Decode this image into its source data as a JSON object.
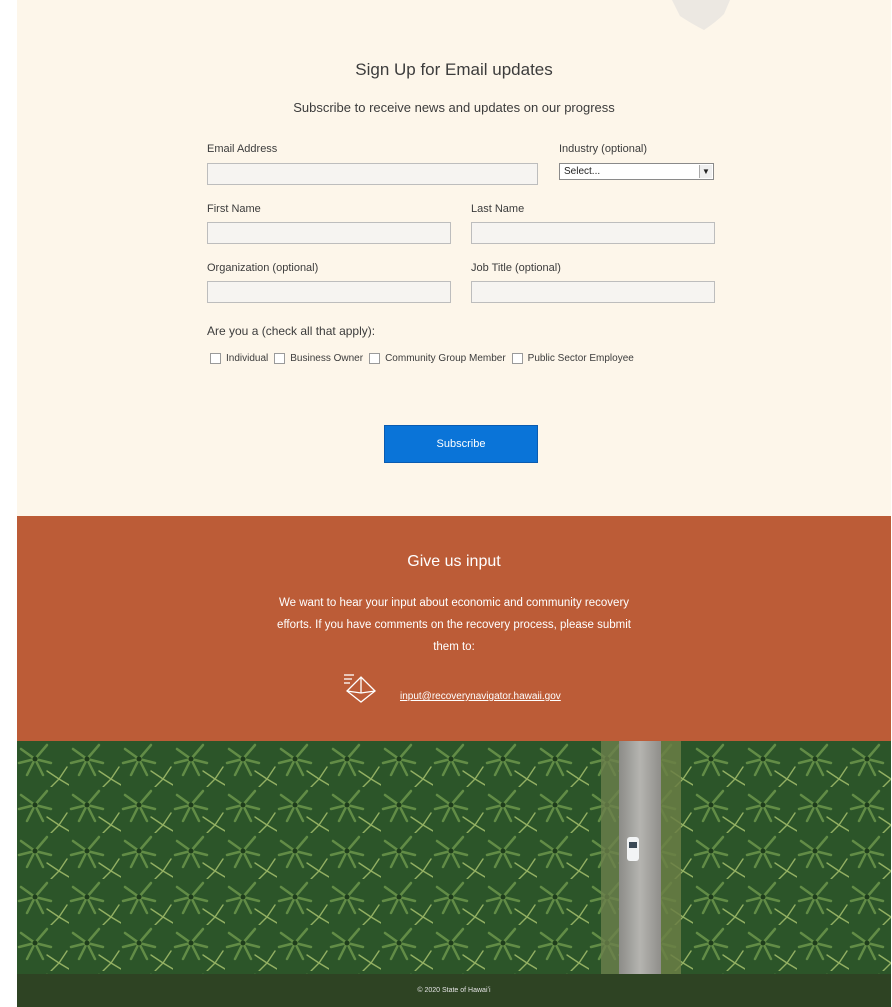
{
  "signup": {
    "title": "Sign Up for Email updates",
    "subtitle": "Subscribe to receive news and updates on our progress",
    "email_label": "Email Address",
    "email_value": "",
    "industry_label": "Industry (optional)",
    "industry_selected": "Select...",
    "first_name_label": "First Name",
    "first_name_value": "",
    "last_name_label": "Last Name",
    "last_name_value": "",
    "organization_label": "Organization (optional)",
    "organization_value": "",
    "job_title_label": "Job Title (optional)",
    "job_title_value": "",
    "question": "Are you a (check all that apply):",
    "options": [
      "Individual",
      "Business Owner",
      "Community Group Member",
      "Public Sector Employee"
    ],
    "subscribe_label": "Subscribe"
  },
  "input_section": {
    "title": "Give us input",
    "body": "We want to hear your input about economic and community recovery efforts. If you have comments on the recovery process, please submit them to:",
    "email": "input@recoverynavigator.hawaii.gov",
    "icon": "mail-icon"
  },
  "footer": {
    "copyright": "© 2020 State of Hawaiʻi"
  },
  "colors": {
    "signup_bg": "#fdf6ea",
    "accent_button": "#0a74d8",
    "input_bg": "#bc5c37",
    "footer_bg": "#2e4323"
  }
}
